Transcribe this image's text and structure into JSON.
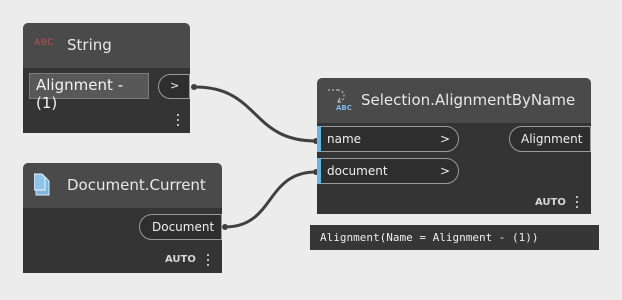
{
  "colors": {
    "canvas": "#ececec",
    "node_header": "#4a4a4a",
    "node_body": "#343434",
    "input_marker": "#6ab4e0",
    "wire": "#404040"
  },
  "nodes": {
    "string": {
      "title": "String",
      "icon": "abc-icon",
      "icon_text": "ABC",
      "value": "Alignment - (1)",
      "output_arrow": ">"
    },
    "document_current": {
      "title": "Document.Current",
      "icon": "document-icon",
      "output_label": "Document",
      "lacing": "AUTO"
    },
    "selection": {
      "title": "Selection.AlignmentByName",
      "icon": "selection-abc-icon",
      "icon_text": "ABC",
      "inputs": [
        {
          "label": "name",
          "arrow": ">"
        },
        {
          "label": "document",
          "arrow": ">"
        }
      ],
      "output_label": "Alignment",
      "lacing": "AUTO",
      "preview": "Alignment(Name = Alignment - (1))"
    }
  }
}
